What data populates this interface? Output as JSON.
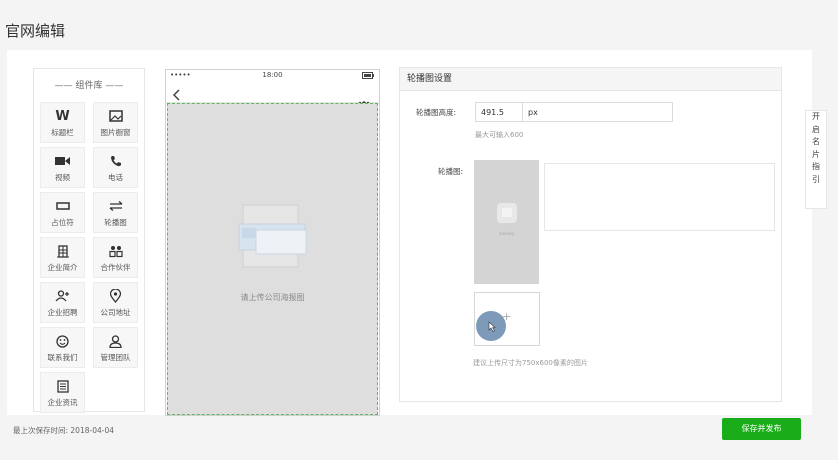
{
  "page_title": "官网编辑",
  "palette": {
    "title": "—— 组件库 ——",
    "items": [
      {
        "label": "标题栏",
        "icon": "title-bar-icon"
      },
      {
        "label": "图片橱窗",
        "icon": "image-icon"
      },
      {
        "label": "视频",
        "icon": "video-icon"
      },
      {
        "label": "电话",
        "icon": "phone-icon"
      },
      {
        "label": "占位符",
        "icon": "placeholder-icon"
      },
      {
        "label": "轮播图",
        "icon": "carousel-icon"
      },
      {
        "label": "企业简介",
        "icon": "building-icon"
      },
      {
        "label": "合作伙伴",
        "icon": "partners-icon"
      },
      {
        "label": "企业招聘",
        "icon": "add-user-icon"
      },
      {
        "label": "公司地址",
        "icon": "location-icon"
      },
      {
        "label": "联系我们",
        "icon": "smile-icon"
      },
      {
        "label": "管理团队",
        "icon": "team-icon"
      },
      {
        "label": "企业资讯",
        "icon": "news-icon"
      }
    ]
  },
  "phone": {
    "signal": "•••••",
    "time": "18:00",
    "upload_hint": "请上传公司海报图"
  },
  "settings": {
    "header": "轮播图设置",
    "height_label": "轮播图高度:",
    "height_value": "491.5",
    "height_unit": "px",
    "height_hint": "最大可输入600",
    "carousel_label": "轮播图:",
    "thumb_caption": "loading",
    "size_hint": "建议上传尺寸为750x600像素的图片"
  },
  "side_tab": [
    "开",
    "启",
    "名",
    "片",
    "指",
    "引"
  ],
  "footer": {
    "save_time": "最上次保存时间:  2018-04-04",
    "publish_label": "保存并发布"
  },
  "colors": {
    "accent_green": "#1aad19",
    "canvas_dash": "#5cb85c"
  }
}
